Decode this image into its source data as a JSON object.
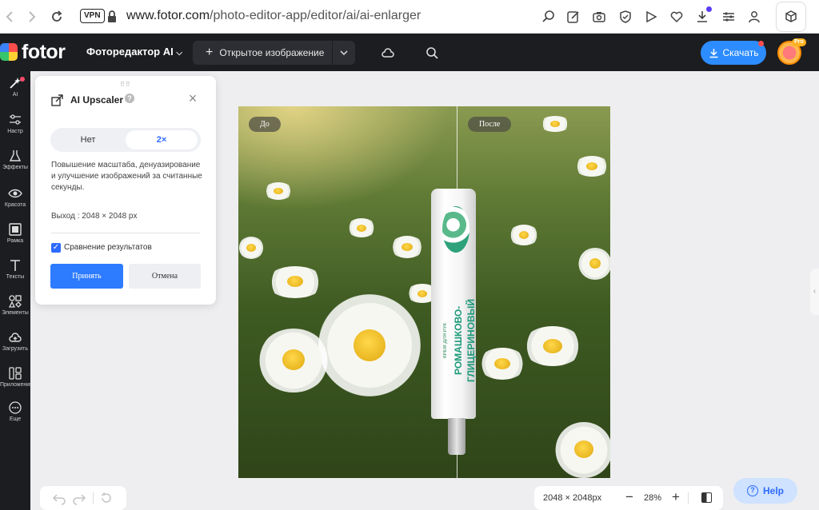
{
  "browser": {
    "vpn_label": "VPN",
    "url_host": "www.fotor.com",
    "url_path": "/photo-editor-app/editor/ai/ai-enlarger"
  },
  "header": {
    "logo_text": "fotor",
    "editor_menu": "Фоторедактор AI",
    "open_image": "Открытое изображение",
    "download": "Скачать",
    "pro_badge": "Pro"
  },
  "toolbar": {
    "items": [
      {
        "label": "AI",
        "icon": "sparkle-wand-icon"
      },
      {
        "label": "Настр",
        "icon": "sliders-icon"
      },
      {
        "label": "Эффекты",
        "icon": "flask-icon"
      },
      {
        "label": "Красота",
        "icon": "eye-icon"
      },
      {
        "label": "Рамка",
        "icon": "frame-icon"
      },
      {
        "label": "Тексты",
        "icon": "text-icon"
      },
      {
        "label": "Элементы",
        "icon": "shapes-icon"
      },
      {
        "label": "Загрузить",
        "icon": "cloud-upload-icon"
      },
      {
        "label": "Приложения",
        "icon": "apps-icon"
      },
      {
        "label": "Еще",
        "icon": "more-icon"
      }
    ]
  },
  "panel": {
    "title": "AI Upscaler",
    "help": "?",
    "options": {
      "none": "Нет",
      "x2": "2×"
    },
    "selected": "2×",
    "description": "Повышение масштаба, денуазирование и улучшение изображений за считанные секунды.",
    "output": "Выход : 2048 × 2048 px",
    "compare_label": "Сравнение результатов",
    "compare_checked": true,
    "apply": "Принять",
    "cancel": "Отмена"
  },
  "image": {
    "before_label": "До",
    "after_label": "После",
    "tube_text": "РОМАШКОВО-ГЛИЦЕРИНОВЫЙ",
    "tube_small": "КРЕМ ДЛЯ РУК"
  },
  "zoom": {
    "dimensions": "2048 × 2048px",
    "minus": "−",
    "value": "28%",
    "plus": "+"
  },
  "help": {
    "label": "Help"
  },
  "colors": {
    "accent": "#2d7bff",
    "header_bg": "#1c1d20",
    "canvas_bg": "#eeeef0"
  }
}
